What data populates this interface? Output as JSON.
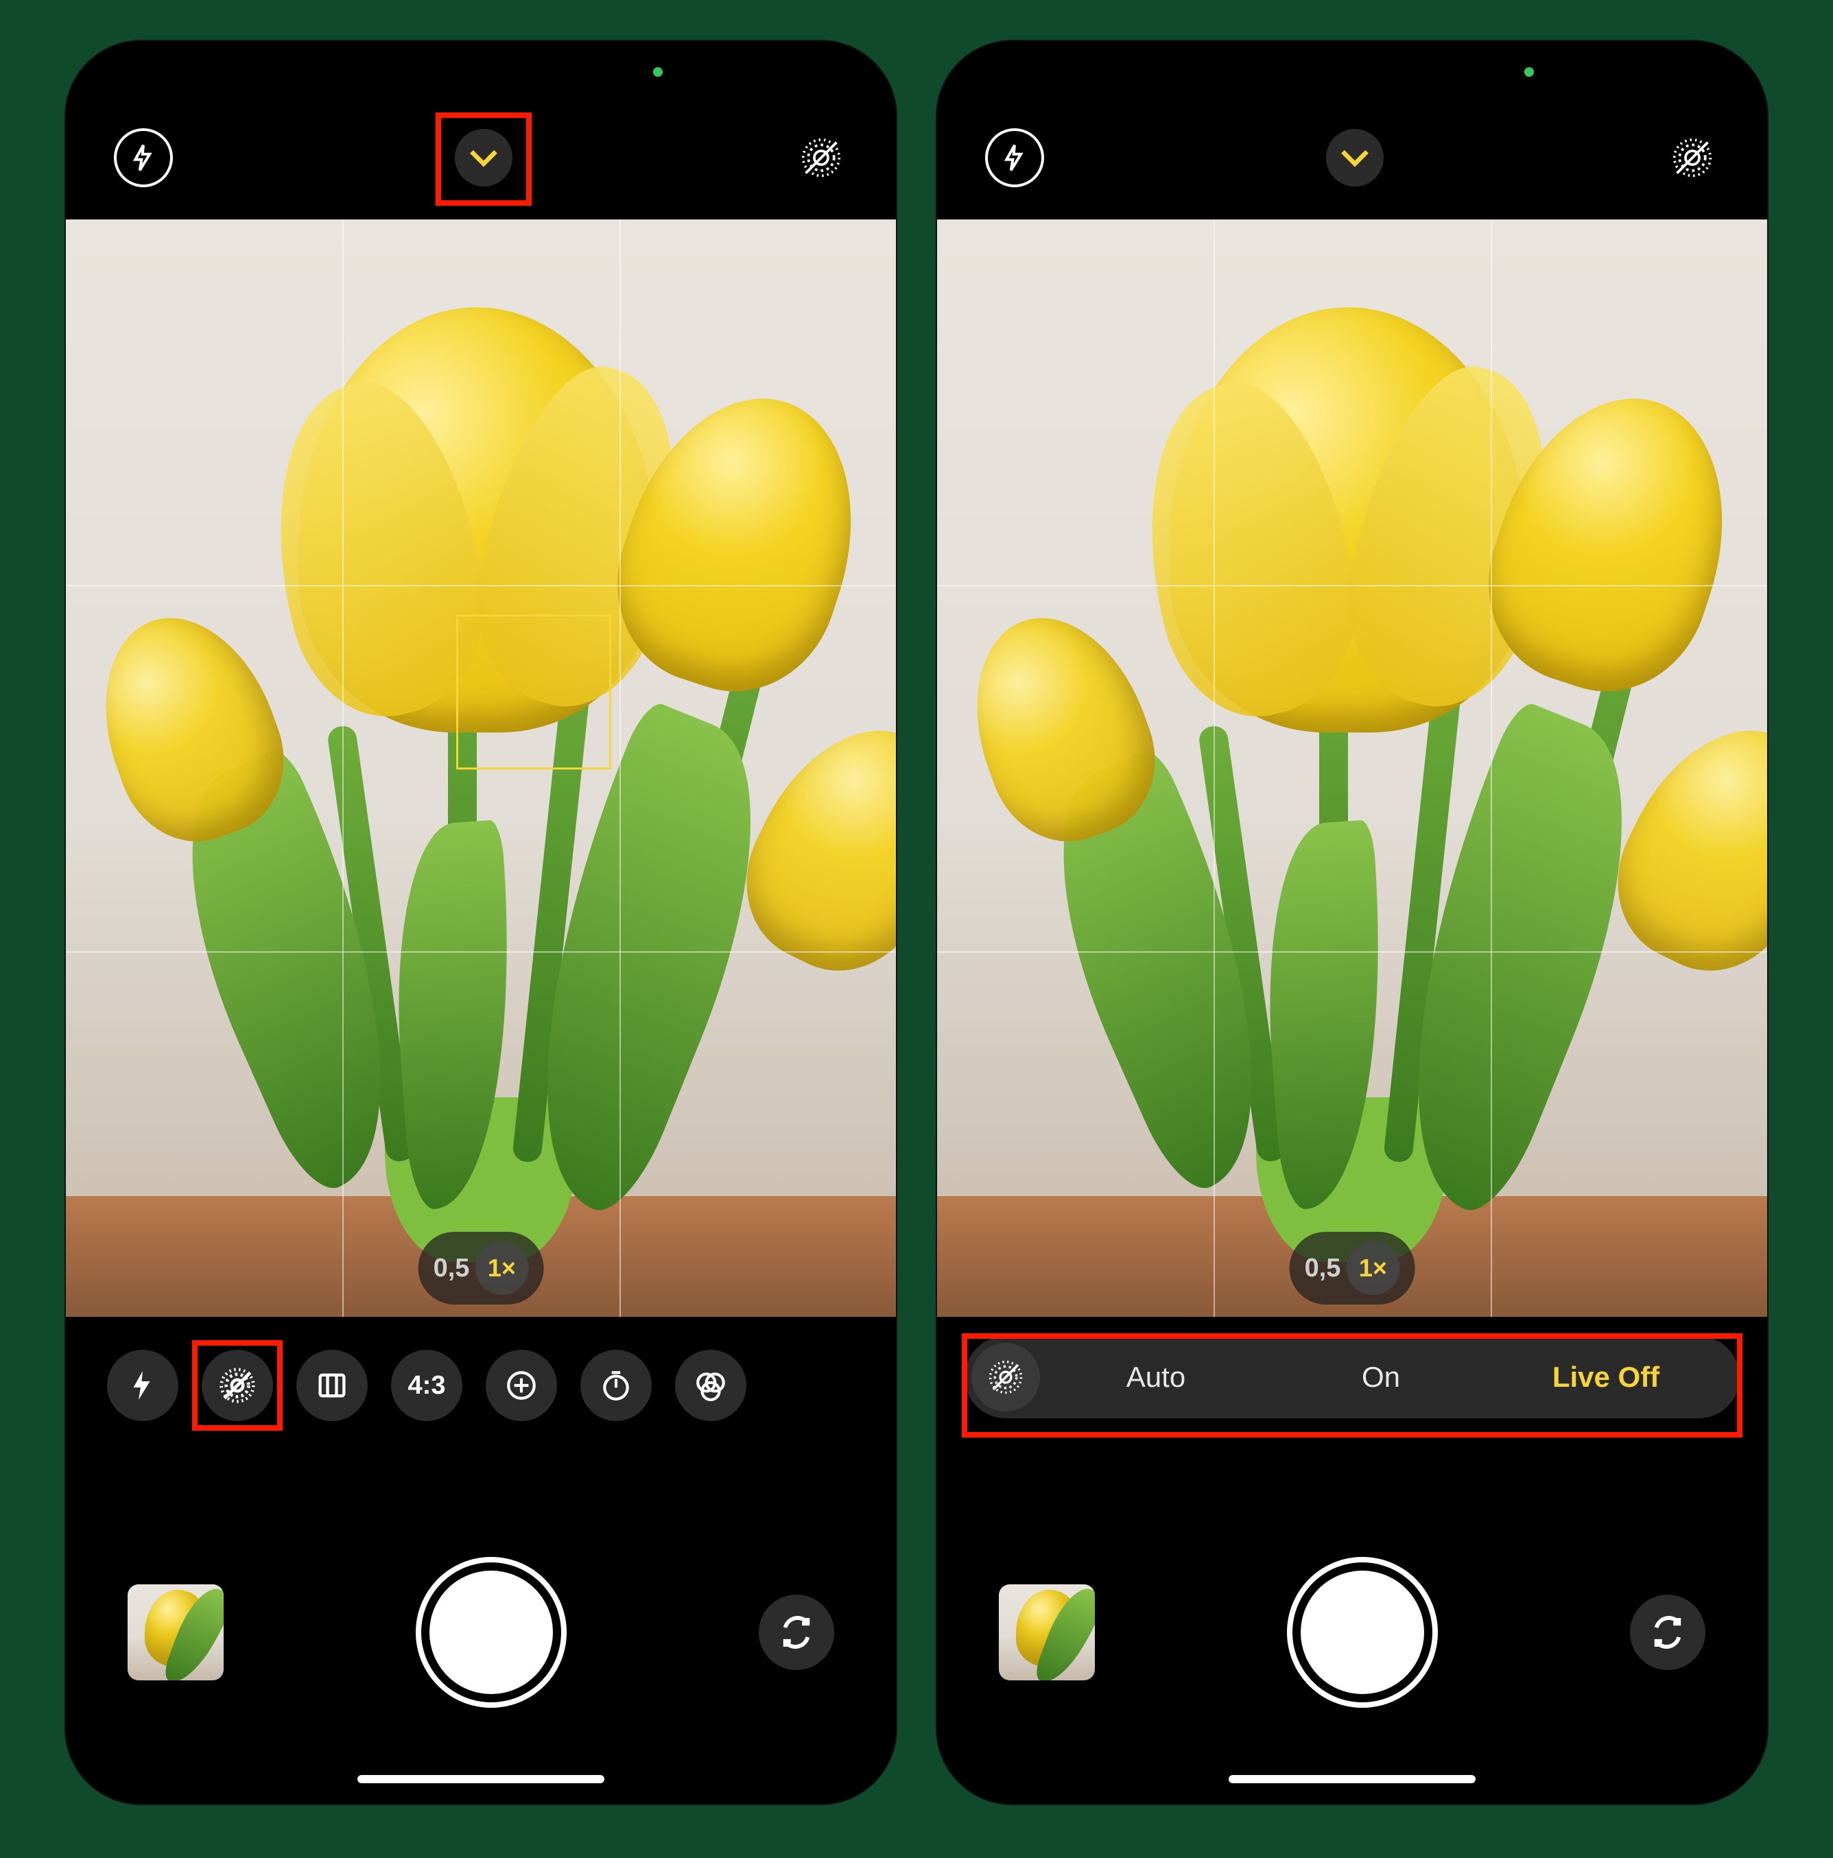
{
  "annotation": {
    "screens": [
      "left",
      "right"
    ],
    "highlights": {
      "left": [
        "chevron-toggle",
        "live-photo-tool"
      ],
      "right": [
        "live-photo-options-bar"
      ]
    }
  },
  "colors": {
    "accent": "#f7d538",
    "highlight": "#ff1a00",
    "page_bg": "#0f4a2c"
  },
  "left": {
    "top": {
      "flash_icon": "flash-off",
      "chevron_icon": "chevron-down",
      "live_icon": "live-photo-off"
    },
    "viewfinder": {
      "grid": true,
      "focus_square": true,
      "subject": "yellow tulips in green vase"
    },
    "zoom": {
      "alt": "0,5",
      "selected": "1×"
    },
    "tools": [
      {
        "name": "flash",
        "label": "",
        "icon": "flash"
      },
      {
        "name": "live-photo",
        "label": "",
        "icon": "live-photo-off"
      },
      {
        "name": "styles",
        "label": "",
        "icon": "photographic-styles"
      },
      {
        "name": "aspect",
        "label": "4:3",
        "icon": ""
      },
      {
        "name": "exposure",
        "label": "",
        "icon": "exposure-dial"
      },
      {
        "name": "timer",
        "label": "",
        "icon": "timer"
      },
      {
        "name": "filters",
        "label": "",
        "icon": "filters"
      }
    ],
    "capture": {
      "thumbnail_desc": "last photo: yellow tulips",
      "shutter": "shutter",
      "flip": "switch-camera"
    }
  },
  "right": {
    "top": {
      "flash_icon": "flash-off",
      "chevron_icon": "chevron-down",
      "live_icon": "live-photo-off"
    },
    "viewfinder": {
      "grid": true,
      "focus_square": false,
      "subject": "yellow tulips in green vase"
    },
    "zoom": {
      "alt": "0,5",
      "selected": "1×"
    },
    "live_options": {
      "lead_icon": "live-photo-off",
      "options": [
        {
          "label": "Auto",
          "selected": false
        },
        {
          "label": "On",
          "selected": false
        },
        {
          "label": "Live Off",
          "selected": true
        }
      ]
    },
    "capture": {
      "thumbnail_desc": "last photo: yellow tulips",
      "shutter": "shutter",
      "flip": "switch-camera"
    }
  }
}
